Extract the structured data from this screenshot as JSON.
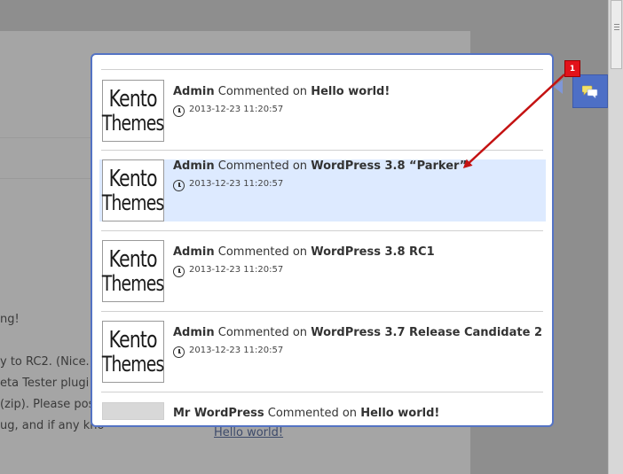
{
  "background": {
    "text_lines": [
      "ng!",
      "y to RC2. (Nice.)",
      "eta Tester plugi",
      "(zip). Please pos",
      "ug, and if any kno"
    ],
    "link": "Hello world!"
  },
  "notification": {
    "badge_count": "1",
    "icon": "chat-bubbles-icon"
  },
  "popup": {
    "items": [
      {
        "thumb_line1": "Kento",
        "thumb_line2": "Themes",
        "author": "Admin",
        "action": "Commented on",
        "post": "Hello world!",
        "time": "2013-12-23 11:20:57"
      },
      {
        "thumb_line1": "Kento",
        "thumb_line2": "Themes",
        "author": "Admin",
        "action": "Commented on",
        "post": "WordPress 3.8 “Parker”",
        "time": "2013-12-23 11:20:57"
      },
      {
        "thumb_line1": "Kento",
        "thumb_line2": "Themes",
        "author": "Admin",
        "action": "Commented on",
        "post": "WordPress 3.8 RC1",
        "time": "2013-12-23 11:20:57"
      },
      {
        "thumb_line1": "Kento",
        "thumb_line2": "Themes",
        "author": "Admin",
        "action": "Commented on",
        "post": "WordPress 3.7 Release Candidate 2",
        "time": "2013-12-23 11:20:57"
      },
      {
        "author": "Mr WordPress",
        "action": "Commented on",
        "post": "Hello world!"
      }
    ]
  },
  "colors": {
    "accent": "#4d6fc6",
    "badge": "#e3121a",
    "highlight": "#ddeaff",
    "annotation_arrow": "#c41212"
  }
}
